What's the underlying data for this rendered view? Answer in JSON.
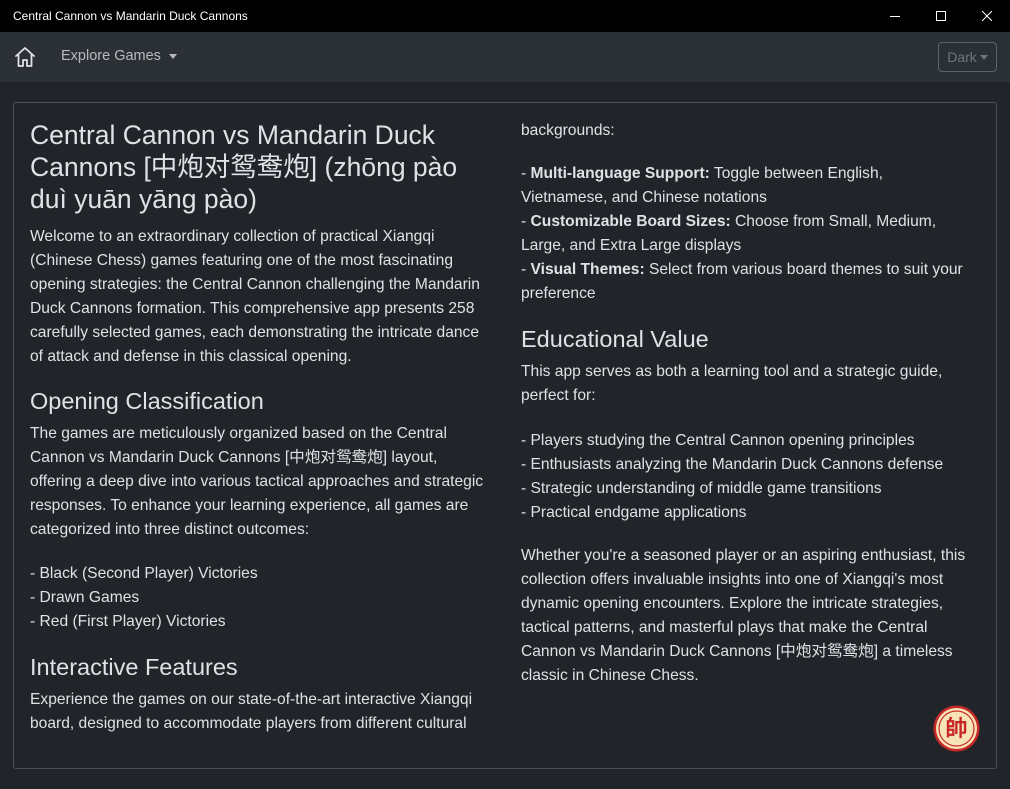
{
  "window": {
    "title": "Central Cannon vs Mandarin Duck Cannons"
  },
  "navbar": {
    "explore_label": "Explore Games",
    "theme_label": "Dark"
  },
  "left": {
    "heading": "Central Cannon vs Mandarin Duck Cannons [中炮对鸳鸯炮] (zhōng pào duì yuān yāng pào)",
    "intro": "Welcome to an extraordinary collection of practical Xiangqi (Chinese Chess) games featuring one of the most fascinating opening strategies: the Central Cannon challenging the Mandarin Duck Cannons formation. This comprehensive app presents 258 carefully selected games, each demonstrating the intricate dance of attack and defense in this classical opening.",
    "classification_heading": "Opening Classification",
    "classification_text": "The games are meticulously organized based on the Central Cannon vs Mandarin Duck Cannons [中炮对鸳鸯炮] layout, offering a deep dive into various tactical approaches and strategic responses. To enhance your learning experience, all games are categorized into three distinct outcomes:",
    "outcomes": [
      "- Black (Second Player) Victories",
      "- Drawn Games",
      "- Red (First Player) Victories"
    ],
    "features_heading": "Interactive Features",
    "features_text": "Experience the games on our state-of-the-art interactive Xiangqi board, designed to accommodate players from different cultural"
  },
  "right": {
    "features_cont": "backgrounds:",
    "features": [
      {
        "bold": "Multi-language Support:",
        "text": " Toggle between English,"
      },
      {
        "text": "Vietnamese, and Chinese notations"
      },
      {
        "bold": "Customizable Board Sizes:",
        "text": " Choose from Small, Medium,"
      },
      {
        "text": "Large, and Extra Large displays"
      },
      {
        "bold": "Visual Themes:",
        "text": " Select from various board themes to suit your"
      },
      {
        "text": "preference"
      }
    ],
    "edu_heading": "Educational Value",
    "edu_intro": "This app serves as both a learning tool and a strategic guide, perfect for:",
    "edu_items": [
      "- Players studying the Central Cannon opening principles",
      "- Enthusiasts analyzing the Mandarin Duck Cannons defense",
      "- Strategic understanding of middle game transitions",
      "- Practical endgame applications"
    ],
    "closing": "Whether you're a seasoned player or an aspiring enthusiast, this collection offers invaluable insights into one of Xiangqi's most dynamic opening encounters. Explore the intricate strategies, tactical patterns, and masterful plays that make the Central Cannon vs Mandarin Duck Cannons [中炮对鸳鸯炮] a timeless classic in Chinese Chess."
  },
  "badge": {
    "glyph": "帥"
  },
  "colors": {
    "background": "#212529",
    "navbar": "#2b3035",
    "titlebar": "#000000",
    "text": "#dee2e6",
    "badge_fill": "#f7e4b6",
    "badge_red": "#c62828"
  }
}
